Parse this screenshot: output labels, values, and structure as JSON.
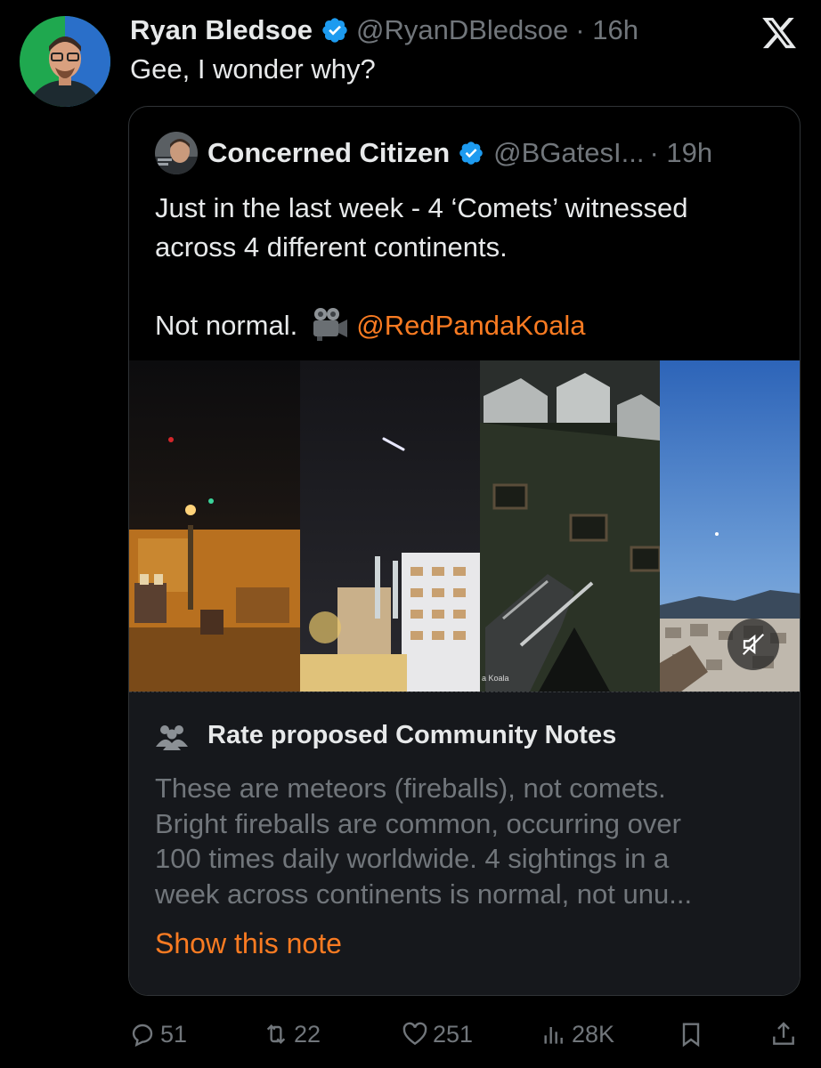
{
  "tweet": {
    "author_name": "Ryan Bledsoe",
    "handle": "@RyanDBledsoe",
    "time": "· 16h",
    "text": "Gee, I wonder why?"
  },
  "quoted": {
    "author_name": "Concerned Citizen",
    "handle": "@BGatesI...",
    "time": "· 19h",
    "text_line1": "Just in the last week - 4 ‘Comets’ witnessed",
    "text_line2": "across 4 different continents.",
    "text_line3": "Not normal.",
    "mention": "@RedPandaKoala",
    "media_watermark": "a Koala"
  },
  "community_notes": {
    "title": "Rate proposed Community Notes",
    "body_lines": [
      "These are meteors (fireballs), not comets.",
      "Bright fireballs are common, occurring over",
      "100 times daily worldwide. 4 sightings in a",
      "week across continents is normal, not unu..."
    ],
    "show_note": "Show this note"
  },
  "actions": {
    "replies": "51",
    "reposts": "22",
    "likes": "251",
    "views": "28K"
  },
  "colors": {
    "background": "#000000",
    "text": "#e7e9ea",
    "muted": "#71767b",
    "accent": "#f97b22",
    "verified": "#1d9bf0",
    "note_bg": "#16181c"
  },
  "icons": [
    "avatar",
    "verified-badge-icon",
    "x-logo-icon",
    "movie-camera-icon",
    "mute-icon",
    "people-icon",
    "reply-icon",
    "repost-icon",
    "like-icon",
    "views-icon",
    "bookmark-icon",
    "share-icon"
  ]
}
